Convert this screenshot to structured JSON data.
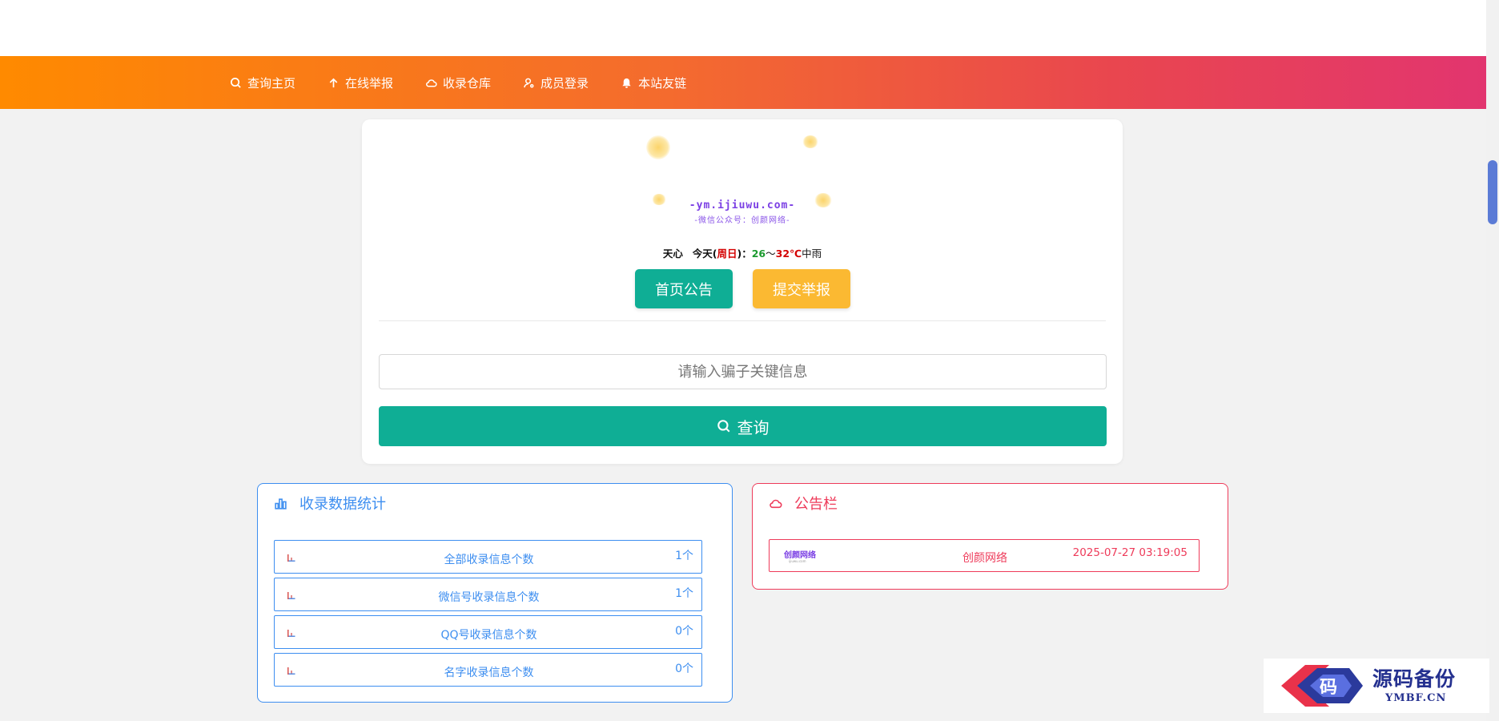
{
  "nav": {
    "items": [
      {
        "label": "查询主页",
        "icon": "search-icon"
      },
      {
        "label": "在线举报",
        "icon": "arrow-up-icon"
      },
      {
        "label": "收录仓库",
        "icon": "cloud-icon"
      },
      {
        "label": "成员登录",
        "icon": "user-icon"
      },
      {
        "label": "本站友链",
        "icon": "bell-icon"
      }
    ]
  },
  "logo": {
    "url_text": "-ym.ijiuwu.com-",
    "sub_text": "-微信公众号：创颜网络-"
  },
  "weather": {
    "city": "天心",
    "today_prefix": "今天(",
    "weekday": "周日",
    "today_suffix": ")：",
    "low": "26",
    "sep": "～",
    "high": "32",
    "unit": "℃",
    "condition": "中雨"
  },
  "buttons": {
    "notice_label": "首页公告",
    "report_label": "提交举报"
  },
  "search": {
    "placeholder": "请输入骗子关键信息",
    "button_label": "查询"
  },
  "stats": {
    "title": "收录数据统计",
    "rows": [
      {
        "label": "全部收录信息个数",
        "value": "1个"
      },
      {
        "label": "微信号收录信息个数",
        "value": "1个"
      },
      {
        "label": "QQ号收录信息个数",
        "value": "0个"
      },
      {
        "label": "名字收录信息个数",
        "value": "0个"
      }
    ]
  },
  "notice": {
    "title": "公告栏",
    "items": [
      {
        "logo_text": "创颜网络",
        "logo_sub": "ijiuwu.com",
        "title": "创颜网络",
        "time": "2025-07-27 03:19:05"
      }
    ]
  },
  "watermark": {
    "glyph": "码",
    "text": "源码备份",
    "sub": "YMBF.CN"
  },
  "colors": {
    "teal": "#0fae95",
    "yellow": "#fbb932",
    "blue": "#3d8ef0",
    "red": "#ee3b5a",
    "nav_start": "#ff8a00",
    "nav_end": "#e2356f"
  }
}
